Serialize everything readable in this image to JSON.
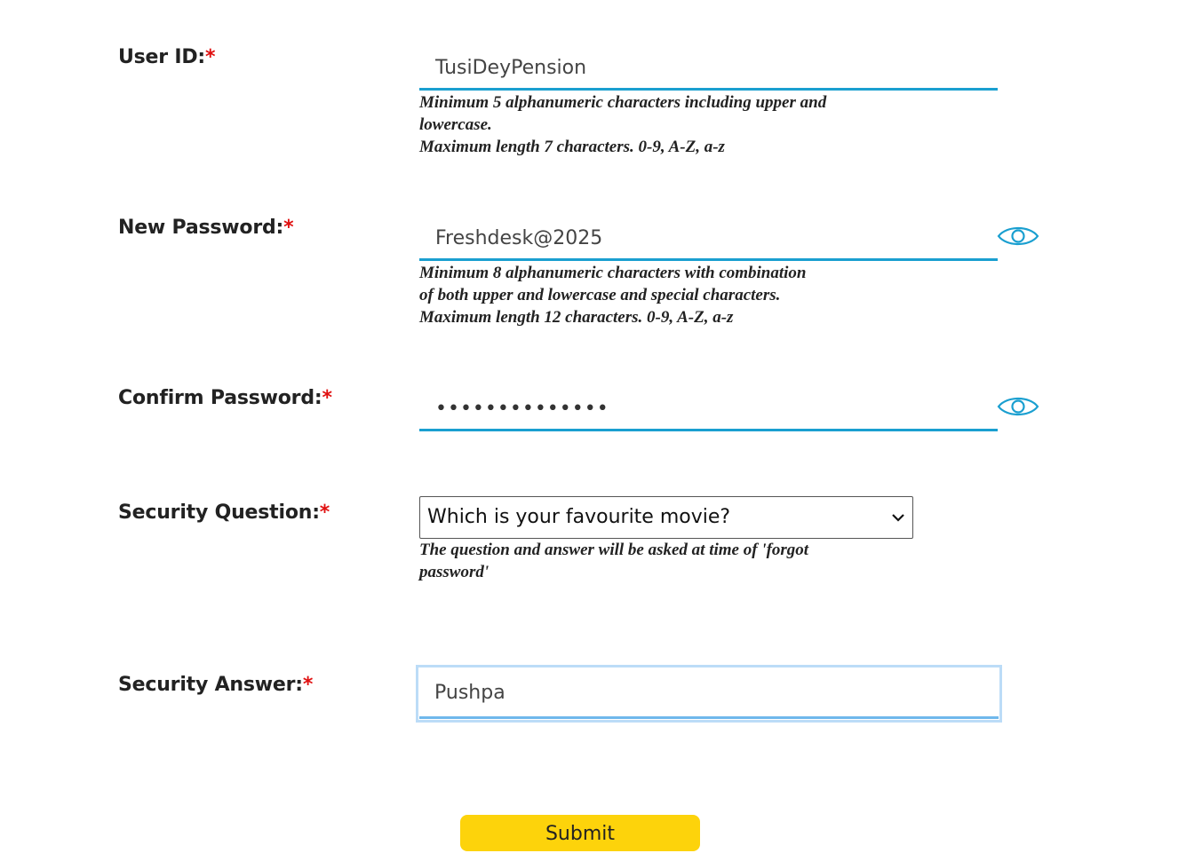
{
  "form": {
    "user_id": {
      "label": "User ID:",
      "required_mark": "*",
      "value": "TusiDeyPension",
      "hint_lines": [
        "Minimum 5 alphanumeric characters including upper and",
        "lowercase.",
        "Maximum length 7 characters. 0-9, A-Z, a-z"
      ]
    },
    "new_password": {
      "label": "New Password:",
      "required_mark": "*",
      "value": "Freshdesk@2025",
      "toggle_icon": "eye-icon",
      "hint_lines": [
        "Minimum 8 alphanumeric characters with combination",
        "of both upper and lowercase and special characters.",
        "Maximum length 12 characters. 0-9, A-Z, a-z"
      ]
    },
    "confirm_password": {
      "label": "Confirm Password:",
      "required_mark": "*",
      "masked_value": "••••••••••••••",
      "toggle_icon": "eye-icon"
    },
    "security_question": {
      "label": "Security Question:",
      "required_mark": "*",
      "selected": "Which is your favourite movie?",
      "hint_lines": [
        "The question and answer will be asked at time of 'forgot",
        "password'"
      ]
    },
    "security_answer": {
      "label": "Security Answer:",
      "required_mark": "*",
      "value": "Pushpa"
    },
    "submit_label": "Submit"
  },
  "colors": {
    "required": "#e01010",
    "input_underline": "#1a9fd0",
    "focus_border": "#bcdcf7",
    "submit_bg": "#fdd30b",
    "eye_icon": "#1a9fd0"
  }
}
